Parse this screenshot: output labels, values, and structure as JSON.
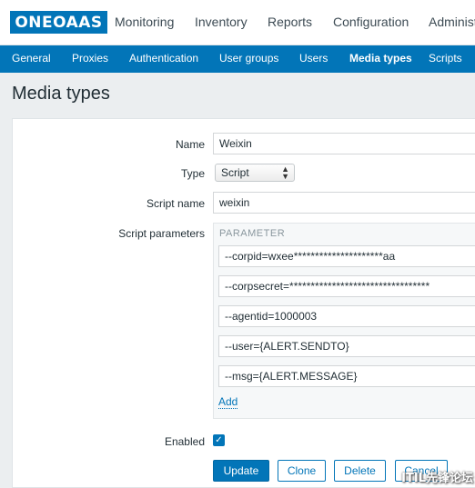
{
  "topnav": {
    "logo": "ONEOAAS",
    "menu": [
      "Monitoring",
      "Inventory",
      "Reports",
      "Configuration",
      "Administ"
    ]
  },
  "subnav": {
    "items": [
      "General",
      "Proxies",
      "Authentication",
      "User groups",
      "Users",
      "Media types",
      "Scripts"
    ],
    "active": "Media types"
  },
  "page": {
    "title": "Media types"
  },
  "form": {
    "name_label": "Name",
    "name_value": "Weixin",
    "type_label": "Type",
    "type_value": "Script",
    "script_name_label": "Script name",
    "script_name_value": "weixin",
    "script_params_label": "Script parameters",
    "param_header": "PARAMETER",
    "params": [
      "--corpid=wxee*********************aa",
      "--corpsecret=*********************************",
      "--agentid=1000003",
      "--user={ALERT.SENDTO}",
      "--msg={ALERT.MESSAGE}"
    ],
    "add_label": "Add",
    "enabled_label": "Enabled",
    "enabled_checked": true,
    "checkmark": "✓"
  },
  "buttons": {
    "update": "Update",
    "clone": "Clone",
    "delete": "Delete",
    "cancel": "Cancel"
  },
  "watermark": "ITIL先锋论坛",
  "colors": {
    "brand": "#0275b8",
    "background": "#ebeef0"
  }
}
